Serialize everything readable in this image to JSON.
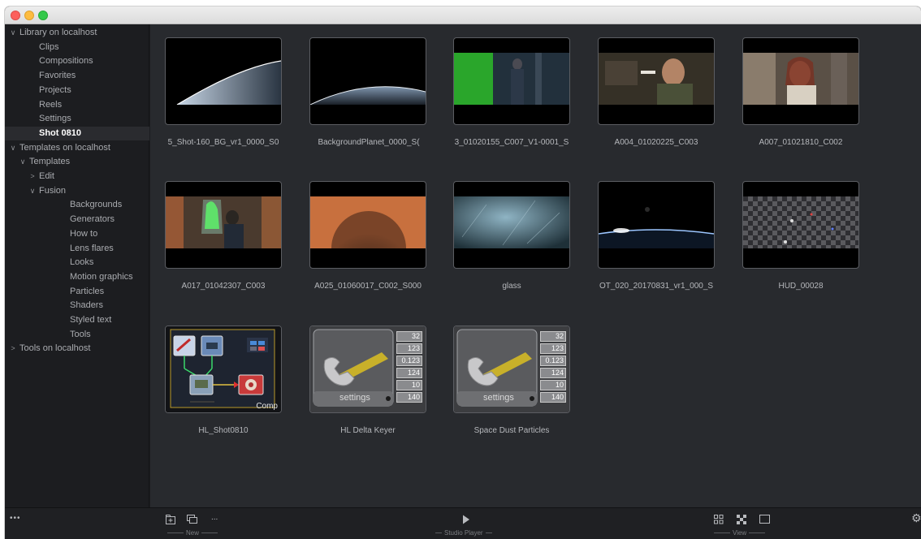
{
  "sidebar": {
    "rows": [
      {
        "label": "Library on localhost",
        "chev": "∨",
        "indent": 0,
        "selected": false
      },
      {
        "label": "Clips",
        "chev": "",
        "indent": 2,
        "selected": false
      },
      {
        "label": "Compositions",
        "chev": "",
        "indent": 2,
        "selected": false
      },
      {
        "label": "Favorites",
        "chev": "",
        "indent": 2,
        "selected": false
      },
      {
        "label": "Projects",
        "chev": "",
        "indent": 2,
        "selected": false
      },
      {
        "label": "Reels",
        "chev": "",
        "indent": 2,
        "selected": false
      },
      {
        "label": "Settings",
        "chev": "",
        "indent": 2,
        "selected": false
      },
      {
        "label": "Shot 0810",
        "chev": "",
        "indent": 2,
        "selected": true
      },
      {
        "label": "Templates on localhost",
        "chev": "∨",
        "indent": 0,
        "selected": false
      },
      {
        "label": "Templates",
        "chev": "∨",
        "indent": 1,
        "selected": false
      },
      {
        "label": "Edit",
        "chev": ">",
        "indent": 2,
        "selected": false
      },
      {
        "label": "Fusion",
        "chev": "∨",
        "indent": 2,
        "selected": false
      },
      {
        "label": "Backgrounds",
        "chev": "",
        "indent": 4,
        "selected": false
      },
      {
        "label": "Generators",
        "chev": "",
        "indent": 4,
        "selected": false
      },
      {
        "label": "How to",
        "chev": "",
        "indent": 4,
        "selected": false
      },
      {
        "label": "Lens flares",
        "chev": "",
        "indent": 4,
        "selected": false
      },
      {
        "label": "Looks",
        "chev": "",
        "indent": 4,
        "selected": false
      },
      {
        "label": "Motion graphics",
        "chev": "",
        "indent": 4,
        "selected": false
      },
      {
        "label": "Particles",
        "chev": "",
        "indent": 4,
        "selected": false
      },
      {
        "label": "Shaders",
        "chev": "",
        "indent": 4,
        "selected": false
      },
      {
        "label": "Styled text",
        "chev": "",
        "indent": 4,
        "selected": false
      },
      {
        "label": "Tools",
        "chev": "",
        "indent": 4,
        "selected": false
      },
      {
        "label": "Tools on localhost",
        "chev": ">",
        "indent": 0,
        "selected": false
      }
    ]
  },
  "grid": {
    "items": [
      {
        "label": "5_Shot-160_BG_vr1_0000_S0",
        "kind": "planet"
      },
      {
        "label": " BackgroundPlanet_0000_S(",
        "kind": "planet2"
      },
      {
        "label": "3_01020155_C007_V1-0001_S",
        "kind": "greenscreen"
      },
      {
        "label": "A004_01020225_C003",
        "kind": "man"
      },
      {
        "label": "A007_01021810_C002",
        "kind": "woman"
      },
      {
        "label": "A017_01042307_C003",
        "kind": "room"
      },
      {
        "label": "A025_01060017_C002_S000",
        "kind": "head"
      },
      {
        "label": "glass",
        "kind": "glass"
      },
      {
        "label": "OT_020_20170831_vr1_000_S",
        "kind": "earth"
      },
      {
        "label": "HUD_00028",
        "kind": "hud"
      },
      {
        "label": "HL_Shot0810",
        "kind": "comp"
      },
      {
        "label": "HL Delta Keyer",
        "kind": "settings"
      },
      {
        "label": "Space Dust Particles",
        "kind": "settings"
      }
    ],
    "comp_badge": "Comp",
    "settings_caption": "settings",
    "settings_values": [
      "32",
      "123",
      "0.123",
      "124",
      "10",
      "140"
    ]
  },
  "bottombar": {
    "new_label": "New",
    "studio_player_label": "Studio Player",
    "view_label": "View",
    "more_left": "•••",
    "more_new": "..."
  },
  "colors": {
    "background": "#282a2e",
    "sidebar": "#1c1d20",
    "selected_row": "#2a2b2f"
  }
}
